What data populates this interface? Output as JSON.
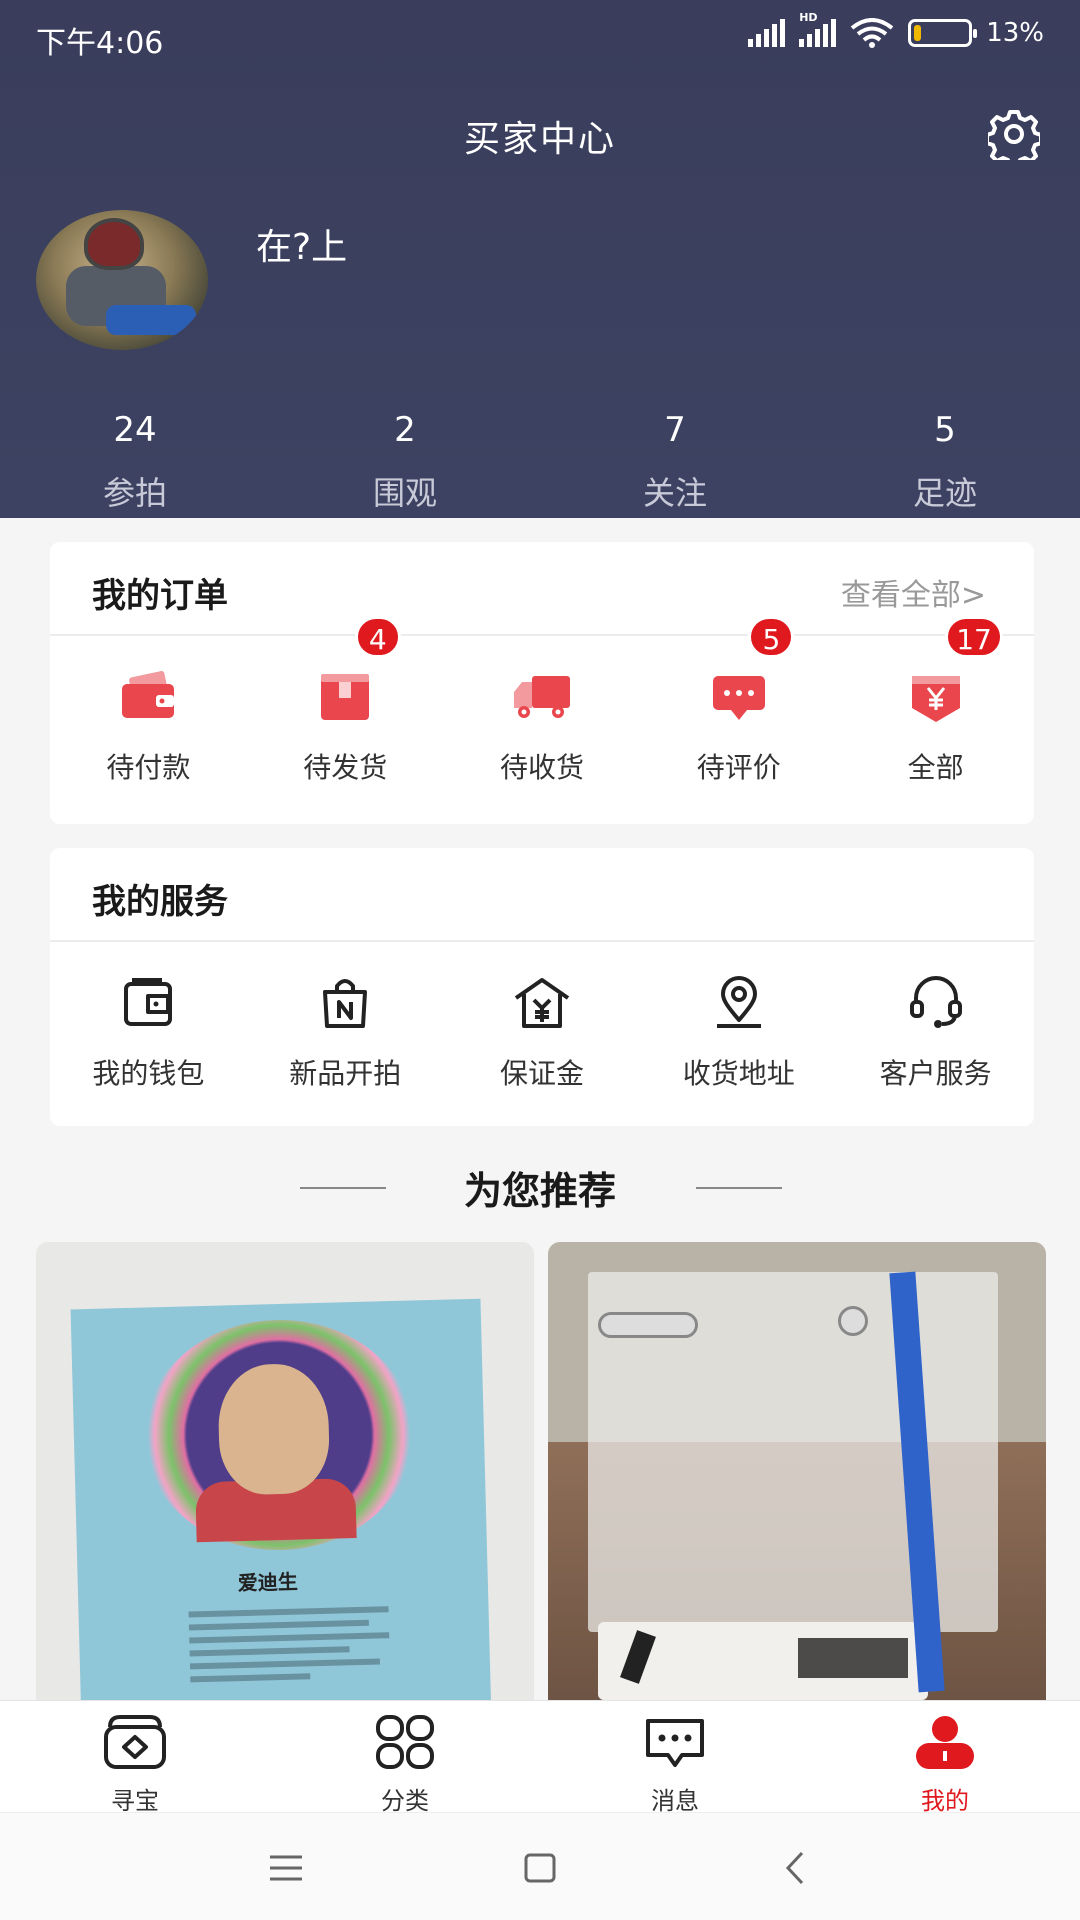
{
  "status_bar": {
    "time": "下午4:06",
    "network": "HD",
    "battery": "13%",
    "battery_level": 0.13
  },
  "header": {
    "title": "买家中心",
    "settings_icon": "gear-icon",
    "username": "在?上"
  },
  "stats": [
    {
      "value": "24",
      "label": "参拍"
    },
    {
      "value": "2",
      "label": "围观"
    },
    {
      "value": "7",
      "label": "关注"
    },
    {
      "value": "5",
      "label": "足迹"
    }
  ],
  "orders": {
    "title": "我的订单",
    "view_all": "查看全部>",
    "items": [
      {
        "label": "待付款",
        "icon": "wallet-icon",
        "badge": ""
      },
      {
        "label": "待发货",
        "icon": "package-icon",
        "badge": "4"
      },
      {
        "label": "待收货",
        "icon": "truck-icon",
        "badge": ""
      },
      {
        "label": "待评价",
        "icon": "comment-icon",
        "badge": "5"
      },
      {
        "label": "全部",
        "icon": "yen-tag-icon",
        "badge": "17"
      }
    ]
  },
  "services": {
    "title": "我的服务",
    "items": [
      {
        "label": "我的钱包",
        "icon": "wallet-outline-icon"
      },
      {
        "label": "新品开拍",
        "icon": "shopping-bag-icon"
      },
      {
        "label": "保证金",
        "icon": "house-yen-icon"
      },
      {
        "label": "收货地址",
        "icon": "location-pin-icon"
      },
      {
        "label": "客户服务",
        "icon": "headset-icon"
      }
    ]
  },
  "recommend": {
    "title": "为您推荐",
    "products": [
      {
        "image": "poster-photo",
        "poster_name": "爱迪生"
      },
      {
        "image": "acrylic-sheet-photo"
      }
    ]
  },
  "tabbar": {
    "active": 3,
    "items": [
      {
        "label": "寻宝",
        "icon": "treasure-icon"
      },
      {
        "label": "分类",
        "icon": "grid-icon"
      },
      {
        "label": "消息",
        "icon": "message-icon"
      },
      {
        "label": "我的",
        "icon": "profile-icon"
      }
    ]
  },
  "colors": {
    "header_bg": "#3a3e5c",
    "accent_red": "#e0191f",
    "icon_red": "#e9474d"
  }
}
